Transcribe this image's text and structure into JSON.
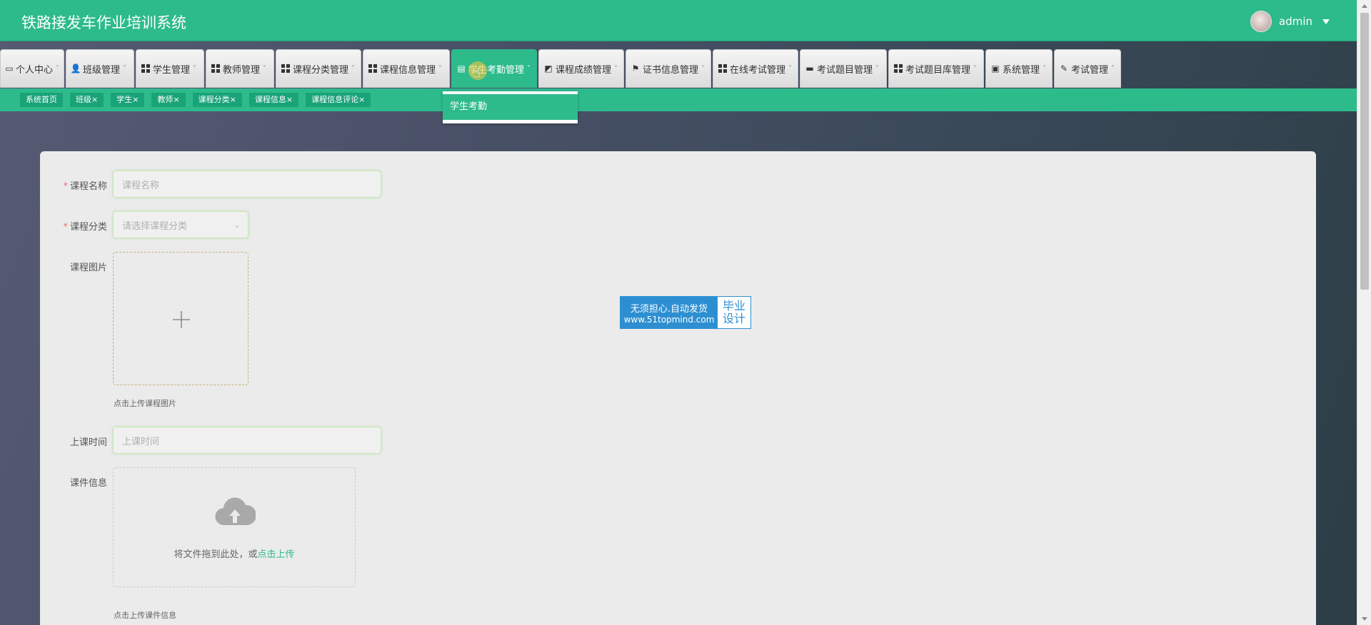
{
  "app": {
    "title": "铁路接发车作业培训系统",
    "username": "admin"
  },
  "menu": [
    {
      "label": "个人中心",
      "icon": "calendar-icon"
    },
    {
      "label": "班级管理",
      "icon": "user-icon"
    },
    {
      "label": "学生管理",
      "icon": "grid-icon"
    },
    {
      "label": "教师管理",
      "icon": "grid-icon"
    },
    {
      "label": "课程分类管理",
      "icon": "grid-icon"
    },
    {
      "label": "课程信息管理",
      "icon": "grid-icon"
    },
    {
      "label": "学生考勤管理",
      "icon": "clipboard-icon",
      "active": true
    },
    {
      "label": "课程成绩管理",
      "icon": "chart-icon"
    },
    {
      "label": "证书信息管理",
      "icon": "flag-icon"
    },
    {
      "label": "在线考试管理",
      "icon": "grid-icon"
    },
    {
      "label": "考试题目管理",
      "icon": "inbox-icon"
    },
    {
      "label": "考试题目库管理",
      "icon": "grid-icon"
    },
    {
      "label": "系统管理",
      "icon": "briefcase-icon"
    },
    {
      "label": "考试管理",
      "icon": "edit-icon"
    }
  ],
  "submenu": {
    "item": "学生考勤"
  },
  "tags": [
    "系统首页",
    "班级",
    "学生",
    "教师",
    "课程分类",
    "课程信息",
    "课程信息评论"
  ],
  "tag_close": "×",
  "form": {
    "course_name": {
      "label": "课程名称",
      "placeholder": "课程名称",
      "required": true
    },
    "course_category": {
      "label": "课程分类",
      "placeholder": "请选择课程分类",
      "required": true
    },
    "course_image": {
      "label": "课程图片",
      "hint": "点击上传课程图片"
    },
    "class_time": {
      "label": "上课时间",
      "placeholder": "上课时间"
    },
    "courseware": {
      "label": "课件信息",
      "drag_text": "将文件拖到此处，或",
      "click_text": "点击上传",
      "hint": "点击上传课件信息"
    },
    "required_mark": "*"
  },
  "watermark": {
    "line1": "无须担心.自动发货",
    "line2": "www.51topmind.com",
    "right1": "毕业",
    "right2": "设计"
  },
  "colors": {
    "brand": "#2dbb8c",
    "tag": "#1aa377",
    "required": "#f56c6c",
    "upload_accent": "#2dbb8c"
  }
}
